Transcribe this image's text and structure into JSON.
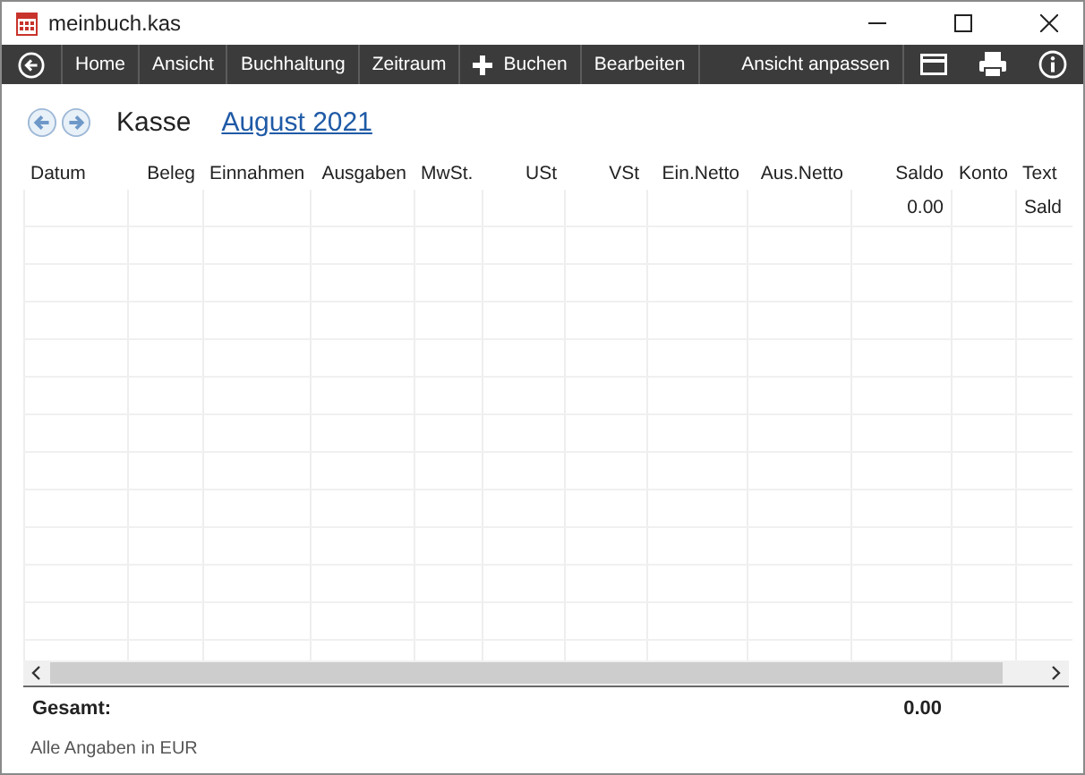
{
  "window": {
    "title": "meinbuch.kas"
  },
  "toolbar": {
    "items": [
      {
        "label": "Home",
        "kind": "text"
      },
      {
        "label": "Ansicht",
        "kind": "text"
      },
      {
        "label": "Buchhaltung",
        "kind": "text"
      },
      {
        "label": "Zeitraum",
        "kind": "text"
      },
      {
        "label": "Buchen",
        "kind": "plus"
      },
      {
        "label": "Bearbeiten",
        "kind": "text"
      }
    ],
    "right_label": "Ansicht anpassen"
  },
  "heading": {
    "title": "Kasse",
    "period": "August 2021"
  },
  "table": {
    "columns": [
      {
        "label": "Datum"
      },
      {
        "label": "Beleg"
      },
      {
        "label": "Einnahmen"
      },
      {
        "label": "Ausgaben"
      },
      {
        "label": "MwSt."
      },
      {
        "label": "USt"
      },
      {
        "label": "VSt"
      },
      {
        "label": "Ein.Netto"
      },
      {
        "label": "Aus.Netto"
      },
      {
        "label": "Saldo"
      },
      {
        "label": "Konto"
      },
      {
        "label": "Text"
      }
    ],
    "rows": [
      [
        "",
        "",
        "",
        "",
        "",
        "",
        "",
        "",
        "",
        "0.00",
        "",
        "Sald"
      ]
    ]
  },
  "totals": {
    "label": "Gesamt:",
    "saldo": "0.00"
  },
  "footer": "Alle Angaben in EUR"
}
